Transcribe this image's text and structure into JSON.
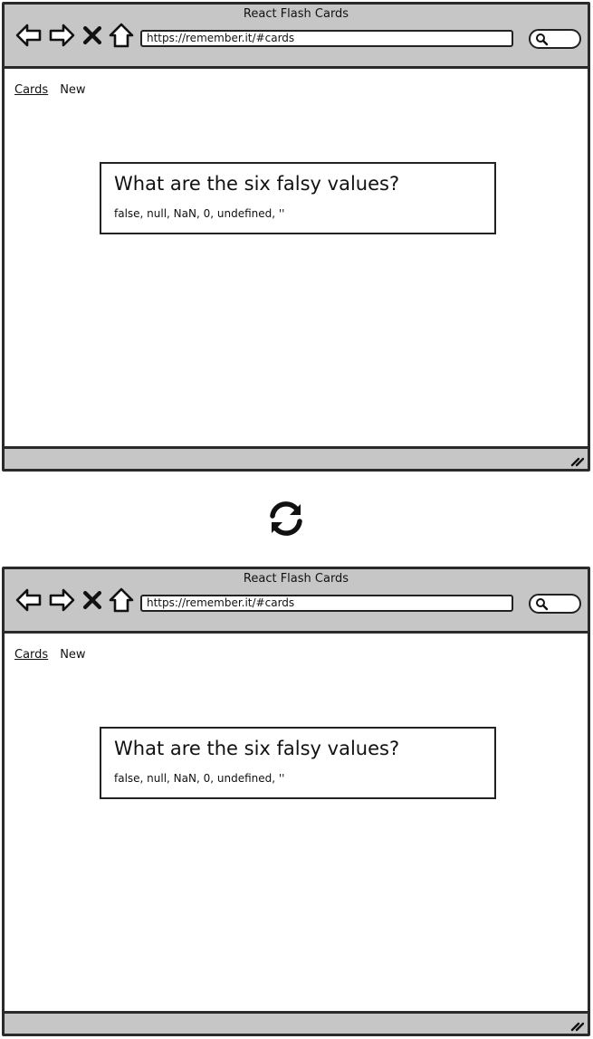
{
  "colors": {
    "chrome": "#c6c6c6",
    "border": "#2a2a2a",
    "ink": "#111111",
    "background": "#ffffff"
  },
  "frames": [
    {
      "window_title": "React Flash Cards",
      "url": "https://remember.it/#cards",
      "nav": {
        "cards_label": "Cards",
        "new_label": "New"
      },
      "card": {
        "question": "What are the six falsy values?",
        "answer": "false, null, NaN, 0, undefined, ''"
      },
      "icons": [
        "back-arrow-icon",
        "forward-arrow-icon",
        "close-icon",
        "home-icon",
        "search-icon",
        "resize-grip-icon"
      ]
    },
    {
      "window_title": "React Flash Cards",
      "url": "https://remember.it/#cards",
      "nav": {
        "cards_label": "Cards",
        "new_label": "New"
      },
      "card": {
        "question": "What are the six falsy values?",
        "answer": "false, null, NaN, 0, undefined, ''"
      },
      "icons": [
        "back-arrow-icon",
        "forward-arrow-icon",
        "close-icon",
        "home-icon",
        "search-icon",
        "resize-grip-icon"
      ]
    }
  ],
  "transition_icon": "refresh-icon"
}
